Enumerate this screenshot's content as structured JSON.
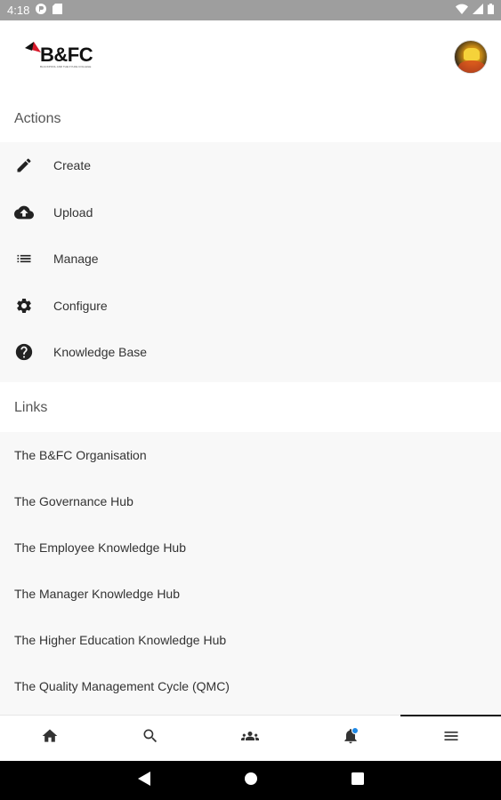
{
  "status_bar": {
    "time": "4:18",
    "left_icons": [
      "app-notification-icon",
      "sd-card-icon"
    ],
    "right_icons": [
      "wifi-icon",
      "cell-signal-icon",
      "battery-icon"
    ]
  },
  "header": {
    "logo_text": "B&FC",
    "logo_subtext": "BLACKPOOL AND THE FYLDE COLLEGE",
    "avatar": "user-avatar"
  },
  "actions": {
    "title": "Actions",
    "items": [
      {
        "label": "Create",
        "icon": "pencil-icon"
      },
      {
        "label": "Upload",
        "icon": "cloud-upload-icon"
      },
      {
        "label": "Manage",
        "icon": "list-icon"
      },
      {
        "label": "Configure",
        "icon": "gear-icon"
      },
      {
        "label": "Knowledge Base",
        "icon": "help-circle-icon"
      }
    ]
  },
  "links": {
    "title": "Links",
    "items": [
      "The B&FC Organisation",
      "The Governance Hub",
      "The Employee Knowledge Hub",
      "The Manager Knowledge Hub",
      "The Higher Education Knowledge Hub",
      "The Quality Management Cycle (QMC)"
    ]
  },
  "bottom_nav": {
    "items": [
      "home-icon",
      "search-icon",
      "people-icon",
      "bell-icon",
      "menu-icon"
    ],
    "active": "menu-icon",
    "badge_color": "#1e88e5"
  },
  "system_nav": [
    "back-icon",
    "home-circle-icon",
    "recents-icon"
  ]
}
